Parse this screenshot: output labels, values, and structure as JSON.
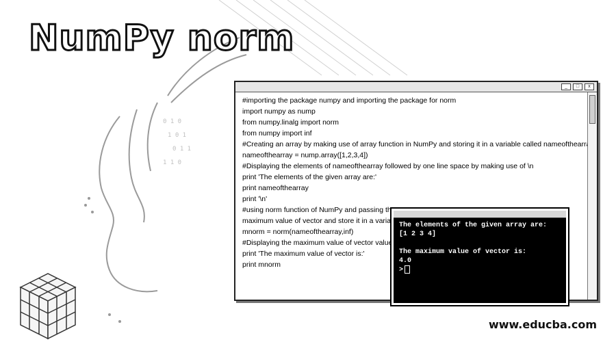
{
  "title": "NumPy norm",
  "editor": {
    "lines": [
      "#importing the package numpy and importing the package for norm",
      "import numpy as nump",
      "from numpy.linalg import norm",
      "from numpy import inf",
      "#Creating an array by making use of array function in NumPy and storing it in a variable called nameofthearray",
      "nameofthearray = nump.array([1,2,3,4])",
      "#Displaying the elements of nameofthearray followed by one line space by making use of \\n",
      "print 'The elements of the given array are:'",
      "print nameofthearray",
      "print '\\n'",
      "#using norm function of NumPy and passing the",
      "maximum value of vector and store it in a variabl",
      "mnorm = norm(nameofthearray,inf)",
      "#Displaying the maximum value of vector value s",
      "print 'The maximum value of vector is:'",
      "print mnorm"
    ]
  },
  "console": {
    "lines": [
      "The elements of the given array are:",
      "[1 2 3 4]",
      "",
      "The maximum value of vector is:",
      "4.0",
      ">"
    ]
  },
  "window_buttons": [
    "_",
    "□",
    "x"
  ],
  "watermark": "www.educba.com"
}
